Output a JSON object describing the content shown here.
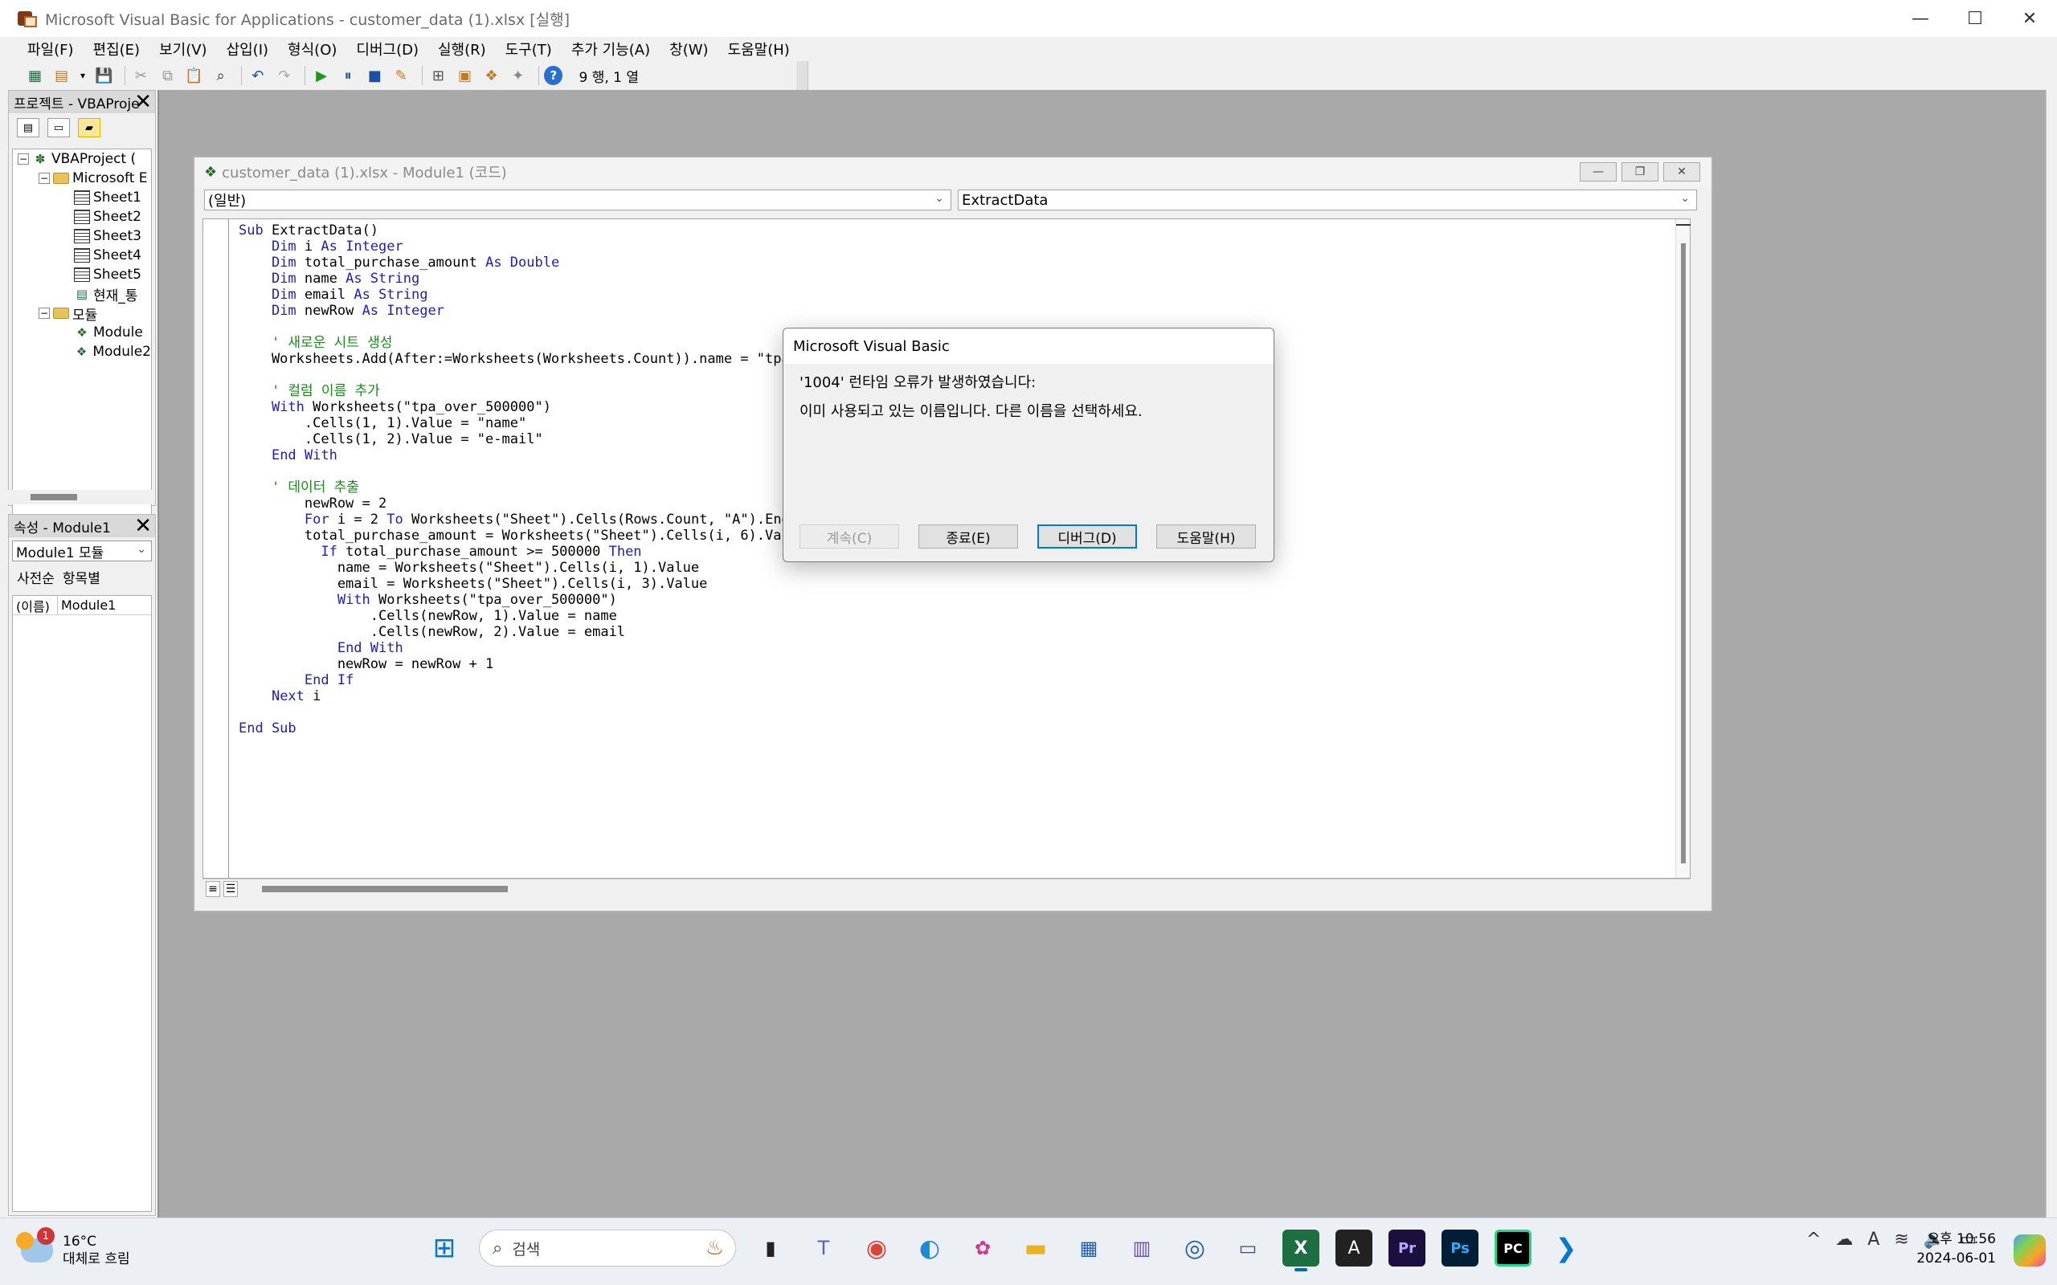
{
  "window": {
    "title": "Microsoft Visual Basic for Applications - customer_data (1).xlsx [실행]",
    "controls": {
      "minimize": "—",
      "maximize": "☐",
      "close": "✕"
    }
  },
  "menu": [
    "파일(F)",
    "편집(E)",
    "보기(V)",
    "삽입(I)",
    "형식(O)",
    "디버그(D)",
    "실행(R)",
    "도구(T)",
    "추가 기능(A)",
    "창(W)",
    "도움말(H)"
  ],
  "toolbar": {
    "position_text": "9 행, 1 열"
  },
  "project_pane": {
    "title": "프로젝트 - VBAProje",
    "tree": [
      {
        "label": "VBAProject (",
        "level": 0,
        "icon": "project-icon",
        "expander": "−"
      },
      {
        "label": "Microsoft E",
        "level": 1,
        "icon": "folder-icon",
        "expander": "−"
      },
      {
        "label": "Sheet1",
        "level": 2,
        "icon": "sheet-icon"
      },
      {
        "label": "Sheet2",
        "level": 2,
        "icon": "sheet-icon"
      },
      {
        "label": "Sheet3",
        "level": 2,
        "icon": "sheet-icon"
      },
      {
        "label": "Sheet4",
        "level": 2,
        "icon": "sheet-icon"
      },
      {
        "label": "Sheet5",
        "level": 2,
        "icon": "sheet-icon"
      },
      {
        "label": "현재_통",
        "level": 2,
        "icon": "workbook-icon"
      },
      {
        "label": "모듈",
        "level": 1,
        "icon": "folder-icon",
        "expander": "−"
      },
      {
        "label": "Module",
        "level": 2,
        "icon": "module-icon"
      },
      {
        "label": "Module2",
        "level": 2,
        "icon": "module-icon"
      }
    ]
  },
  "properties_pane": {
    "title": "속성 - Module1",
    "selector": "Module1 모듈",
    "tabs": [
      "사전순",
      "항목별"
    ],
    "rows": [
      {
        "key": "(이름)",
        "value": "Module1"
      }
    ]
  },
  "code_window": {
    "title": "customer_data (1).xlsx - Module1 (코드)",
    "object_combo": "(일반)",
    "procedure_combo": "ExtractData",
    "lines": [
      [
        {
          "t": "Sub ",
          "k": "kw"
        },
        {
          "t": "ExtractData()"
        }
      ],
      [
        {
          "t": "    "
        },
        {
          "t": "Dim ",
          "k": "kw"
        },
        {
          "t": "i "
        },
        {
          "t": "As Integer",
          "k": "kw"
        }
      ],
      [
        {
          "t": "    "
        },
        {
          "t": "Dim ",
          "k": "kw"
        },
        {
          "t": "total_purchase_amount "
        },
        {
          "t": "As Double",
          "k": "kw"
        }
      ],
      [
        {
          "t": "    "
        },
        {
          "t": "Dim ",
          "k": "kw"
        },
        {
          "t": "name "
        },
        {
          "t": "As String",
          "k": "kw"
        }
      ],
      [
        {
          "t": "    "
        },
        {
          "t": "Dim ",
          "k": "kw"
        },
        {
          "t": "email "
        },
        {
          "t": "As String",
          "k": "kw"
        }
      ],
      [
        {
          "t": "    "
        },
        {
          "t": "Dim ",
          "k": "kw"
        },
        {
          "t": "newRow "
        },
        {
          "t": "As Integer",
          "k": "kw"
        }
      ],
      [
        {
          "t": ""
        }
      ],
      [
        {
          "t": "    ' 새로운 시트 생성",
          "k": "cm"
        }
      ],
      [
        {
          "t": "    Worksheets.Add(After:=Worksheets(Worksheets.Count)).name = \"tpa_"
        }
      ],
      [
        {
          "t": ""
        }
      ],
      [
        {
          "t": "    ' 컬럼 이름 추가",
          "k": "cm"
        }
      ],
      [
        {
          "t": "    "
        },
        {
          "t": "With ",
          "k": "kw"
        },
        {
          "t": "Worksheets(\"tpa_over_500000\")"
        }
      ],
      [
        {
          "t": "        .Cells(1, 1).Value = \"name\""
        }
      ],
      [
        {
          "t": "        .Cells(1, 2).Value = \"e-mail\""
        }
      ],
      [
        {
          "t": "    "
        },
        {
          "t": "End With",
          "k": "kw"
        }
      ],
      [
        {
          "t": ""
        }
      ],
      [
        {
          "t": "    ' 데이터 추출",
          "k": "cm"
        }
      ],
      [
        {
          "t": "        newRow = 2"
        }
      ],
      [
        {
          "t": "        "
        },
        {
          "t": "For ",
          "k": "kw"
        },
        {
          "t": "i = 2 "
        },
        {
          "t": "To ",
          "k": "kw"
        },
        {
          "t": "Worksheets(\"Sheet\").Cells(Rows.Count, \"A\").End("
        }
      ],
      [
        {
          "t": "        total_purchase_amount = Worksheets(\"Sheet\").Cells(i, 6).Valu"
        }
      ],
      [
        {
          "t": "          "
        },
        {
          "t": "If ",
          "k": "kw"
        },
        {
          "t": "total_purchase_amount >= 500000 "
        },
        {
          "t": "Then",
          "k": "kw"
        }
      ],
      [
        {
          "t": "            name = Worksheets(\"Sheet\").Cells(i, 1).Value"
        }
      ],
      [
        {
          "t": "            email = Worksheets(\"Sheet\").Cells(i, 3).Value"
        }
      ],
      [
        {
          "t": "            "
        },
        {
          "t": "With ",
          "k": "kw"
        },
        {
          "t": "Worksheets(\"tpa_over_500000\")"
        }
      ],
      [
        {
          "t": "                .Cells(newRow, 1).Value = name"
        }
      ],
      [
        {
          "t": "                .Cells(newRow, 2).Value = email"
        }
      ],
      [
        {
          "t": "            "
        },
        {
          "t": "End With",
          "k": "kw"
        }
      ],
      [
        {
          "t": "            newRow = newRow + 1"
        }
      ],
      [
        {
          "t": "        "
        },
        {
          "t": "End If",
          "k": "kw"
        }
      ],
      [
        {
          "t": "    "
        },
        {
          "t": "Next ",
          "k": "kw"
        },
        {
          "t": "i"
        }
      ],
      [
        {
          "t": ""
        }
      ],
      [
        {
          "t": "End Sub",
          "k": "kw"
        }
      ]
    ]
  },
  "dialog": {
    "title": "Microsoft Visual Basic",
    "message_line1": "'1004' 런타임 오류가 발생하였습니다:",
    "message_line2": "이미 사용되고 있는 이름입니다. 다른 이름을 선택하세요.",
    "buttons": {
      "continue": "계속(C)",
      "end": "종료(E)",
      "debug": "디버그(D)",
      "help": "도움말(H)"
    }
  },
  "taskbar": {
    "weather_badge": "1",
    "temperature": "16°C",
    "condition": "대체로 흐림",
    "search_placeholder": "검색",
    "time": "오후 10:56",
    "date": "2024-06-01"
  },
  "colors": {
    "keyword": "#1d1dbf",
    "comment": "#1a8a1a",
    "accent": "#0078d7"
  }
}
